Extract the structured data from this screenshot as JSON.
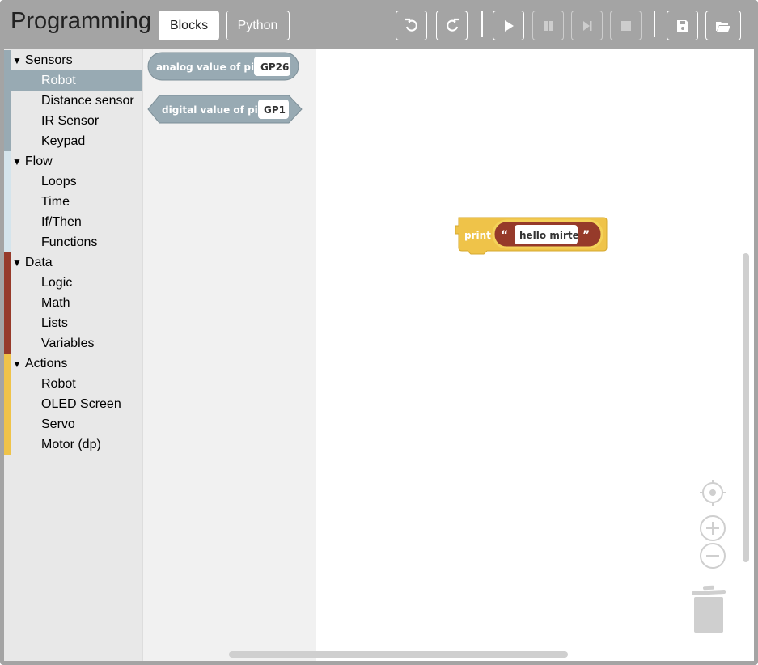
{
  "header": {
    "title": "Programming",
    "mode_tabs": [
      {
        "label": "Blocks",
        "active": true
      },
      {
        "label": "Python",
        "active": false
      }
    ],
    "toolbar_icons": [
      "undo-icon",
      "redo-icon",
      "play-icon",
      "pause-icon",
      "step-icon",
      "stop-icon",
      "save-icon",
      "open-folder-icon"
    ]
  },
  "toolbox": {
    "categories": [
      {
        "label": "Sensors",
        "color": "#98aab3",
        "items": [
          "Robot",
          "Distance sensor",
          "IR Sensor",
          "Keypad"
        ],
        "selected": "Robot"
      },
      {
        "label": "Flow",
        "color": "#d4e4ec",
        "items": [
          "Loops",
          "Time",
          "If/Then",
          "Functions"
        ]
      },
      {
        "label": "Data",
        "color": "#963a2a",
        "items": [
          "Logic",
          "Math",
          "Lists",
          "Variables"
        ]
      },
      {
        "label": "Actions",
        "color": "#efc349",
        "items": [
          "Robot",
          "OLED Screen",
          "Servo",
          "Motor (dp)"
        ]
      }
    ]
  },
  "flyout": {
    "block1": {
      "label": "analog value of pin",
      "field": "GP26"
    },
    "block2": {
      "label": "digital value of pin",
      "field": "GP1"
    }
  },
  "canvas": {
    "print_block": {
      "label": "print",
      "open_quote": "“",
      "text": "hello mirte",
      "close_quote": "”"
    }
  },
  "colors": {
    "chrome": "#a4a4a4",
    "sensor_block": "#98aab3",
    "print_block": "#efc349",
    "text_block": "#963a2a"
  }
}
